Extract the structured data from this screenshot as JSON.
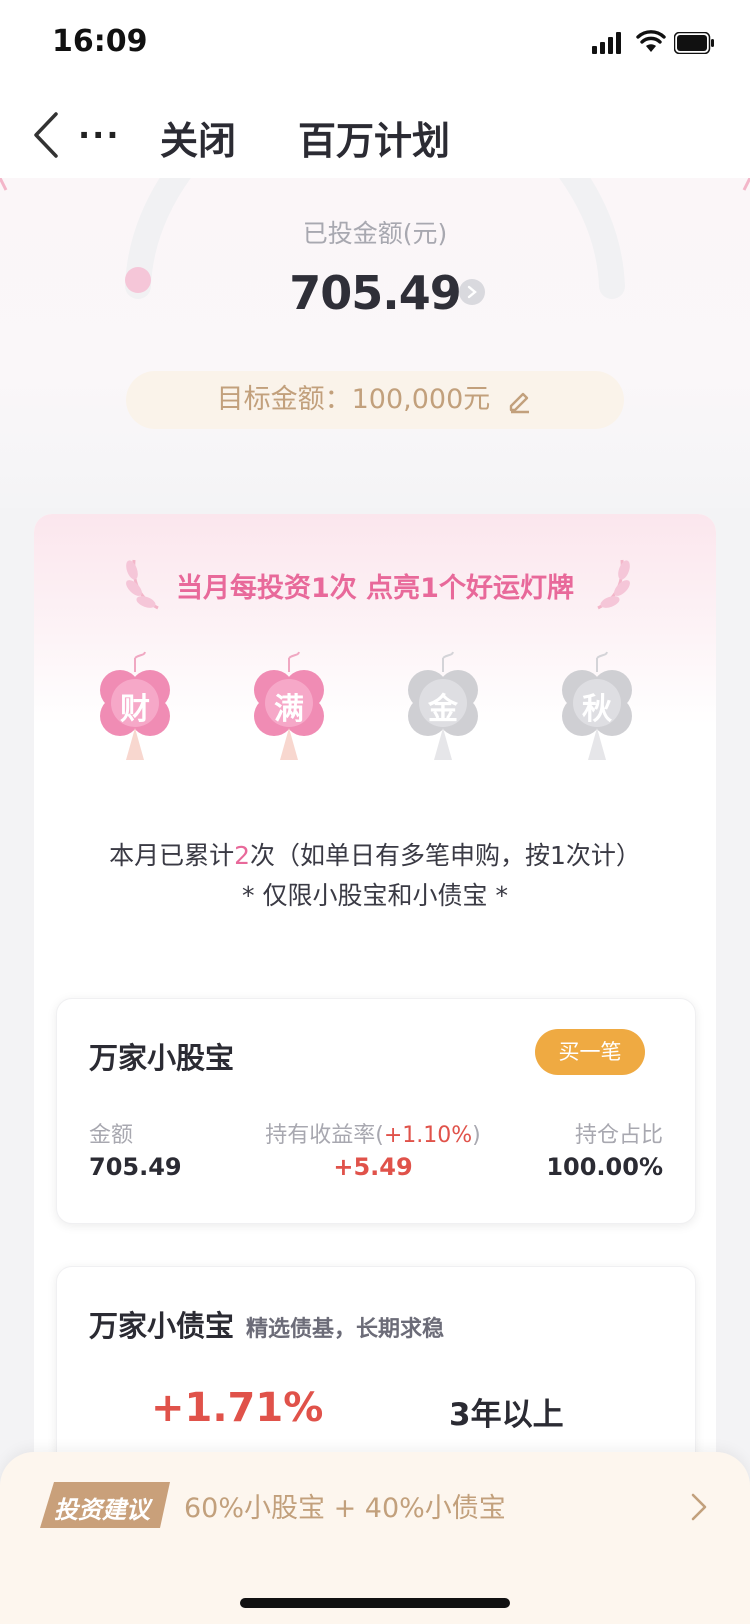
{
  "status_bar": {
    "time": "16:09"
  },
  "nav": {
    "more": "...",
    "close_label": "关闭",
    "title": "百万计划"
  },
  "summary": {
    "invested_label": "已投金额(元)",
    "invested_value": "705.49",
    "target_text": "目标金额：100,000元"
  },
  "promo": {
    "headline": "当月每投资1次 点亮1个好运灯牌",
    "lanterns": [
      {
        "char": "财",
        "lit": true
      },
      {
        "char": "满",
        "lit": true
      },
      {
        "char": "金",
        "lit": false
      },
      {
        "char": "秋",
        "lit": false
      }
    ],
    "count_prefix": "本月已累计",
    "count_value": "2",
    "count_suffix": "次（如单日有多笔申购，按1次计）",
    "limit_note": "* 仅限小股宝和小债宝 *"
  },
  "fund1": {
    "name": "万家小股宝",
    "buy_label": "买一笔",
    "amount_label": "金额",
    "amount_value": "705.49",
    "yield_label": "持有收益率(",
    "yield_rate": "+1.10%",
    "yield_close": ")",
    "yield_value": "+5.49",
    "ratio_label": "持仓占比",
    "ratio_value": "100.00%"
  },
  "fund2": {
    "name": "万家小债宝",
    "subtitle": "精选债基，长期求稳",
    "rate": "+1.71%",
    "period": "3年以上"
  },
  "advice": {
    "tag": "投资建议",
    "text": "60%小股宝 + 40%小债宝"
  },
  "colors": {
    "accent_pink": "#e8699a",
    "gold": "#c2a07c",
    "buy_orange": "#efaa42",
    "gain_red": "#e0524a"
  }
}
